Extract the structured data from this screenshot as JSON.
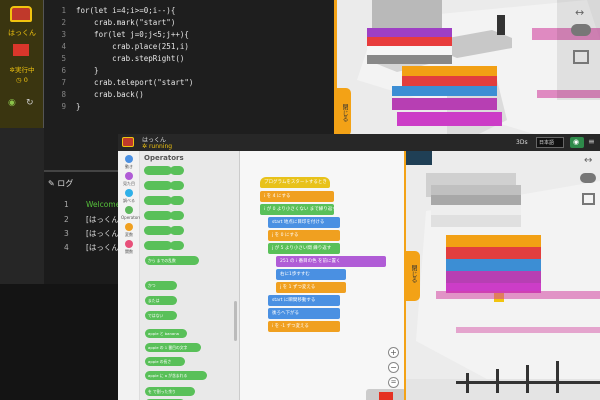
{
  "back_window": {
    "sidebar": {
      "username": "はっくん",
      "status": "実行中",
      "count": "0"
    },
    "code_lines": [
      {
        "n": "1",
        "text": "for(let i=4;i>=0;i--){"
      },
      {
        "n": "2",
        "text": "    crab.mark(\"start\")"
      },
      {
        "n": "3",
        "text": "    for(let j=0;j<5;j++){"
      },
      {
        "n": "4",
        "text": "        crab.place(251,i)"
      },
      {
        "n": "5",
        "text": "        crab.stepRight()"
      },
      {
        "n": "6",
        "text": "    }"
      },
      {
        "n": "7",
        "text": "    crab.teleport(\"start\")"
      },
      {
        "n": "8",
        "text": "    crab.back()"
      },
      {
        "n": "9",
        "text": "}"
      }
    ],
    "scene_side_label": "閉じる",
    "log": {
      "title": "ログ",
      "lines": [
        {
          "n": "1",
          "text": "Welcome to",
          "color": "#56c23b"
        },
        {
          "n": "2",
          "text": "[はっくん] R",
          "color": "#dddddd"
        },
        {
          "n": "3",
          "text": "[はっくん] R",
          "color": "#dddddd"
        },
        {
          "n": "4",
          "text": "[はっくん] R",
          "color": "#dddddd"
        }
      ]
    }
  },
  "front_window": {
    "titlebar": {
      "username": "はっくん",
      "status": "running",
      "zoom": "3Ds",
      "language": "日本語"
    },
    "categories": [
      {
        "label": "動き",
        "color": "#4a90e2"
      },
      {
        "label": "見た目",
        "color": "#b05cd6"
      },
      {
        "label": "調べる",
        "color": "#2eb0e8"
      },
      {
        "label": "Operators",
        "color": "#5cb85c"
      },
      {
        "label": "変数",
        "color": "#f0a020"
      },
      {
        "label": "関数",
        "color": "#e8507a"
      }
    ],
    "palette_title": "Operators",
    "palette_blocks": [
      {
        "text": "",
        "color": "#59c059",
        "w": 28
      },
      {
        "text": "",
        "color": "#59c059",
        "w": 28
      },
      {
        "text": "",
        "color": "#59c059",
        "w": 28
      },
      {
        "text": "",
        "color": "#59c059",
        "w": 28
      },
      {
        "text": "",
        "color": "#59c059",
        "w": 28
      },
      {
        "text": "",
        "color": "#59c059",
        "w": 28
      },
      {
        "text": "から までの乱数",
        "color": "#59c059",
        "w": 54
      },
      {
        "text": "かつ",
        "color": "#59c059",
        "w": 32
      },
      {
        "text": "または",
        "color": "#59c059",
        "w": 32
      },
      {
        "text": "ではない",
        "color": "#59c059",
        "w": 32
      },
      {
        "text": "apple と banana",
        "color": "#59c059",
        "w": 42
      },
      {
        "text": "apple の 1 番目の文字",
        "color": "#59c059",
        "w": 56
      },
      {
        "text": "apple の長さ",
        "color": "#59c059",
        "w": 40
      },
      {
        "text": "apple に a が含まれる",
        "color": "#59c059",
        "w": 62
      },
      {
        "text": "を で割った余り",
        "color": "#59c059",
        "w": 50
      },
      {
        "text": "の絶対値",
        "color": "#59c059",
        "w": 40
      }
    ],
    "script": {
      "hat": "プログラムをスタートするとき",
      "blocks": [
        {
          "text": "i を 4 にする",
          "color": "#f0a020",
          "indent": 0
        },
        {
          "text": "i が 0 より小さくない まで繰り返す",
          "color": "#59c059",
          "indent": 0
        },
        {
          "text": "start 地点に目印を付ける",
          "color": "#4a90e2",
          "indent": 1
        },
        {
          "text": "j を 0 にする",
          "color": "#f0a020",
          "indent": 1
        },
        {
          "text": "j が 5 より小さい間 繰り返す",
          "color": "#59c059",
          "indent": 1
        },
        {
          "text": "251 の i 番目の色 を前に置く",
          "color": "#b05cd6",
          "indent": 2
        },
        {
          "text": "右に1歩すすむ",
          "color": "#4a90e2",
          "indent": 2
        },
        {
          "text": "j を 1 ずつ変える",
          "color": "#f0a020",
          "indent": 2
        },
        {
          "text": "start に瞬間移動する",
          "color": "#4a90e2",
          "indent": 1
        },
        {
          "text": "後ろへ下がる",
          "color": "#4a90e2",
          "indent": 1
        },
        {
          "text": "i を -1 ずつ変える",
          "color": "#f0a020",
          "indent": 1
        }
      ]
    },
    "scene_side_label": "閉じる"
  }
}
